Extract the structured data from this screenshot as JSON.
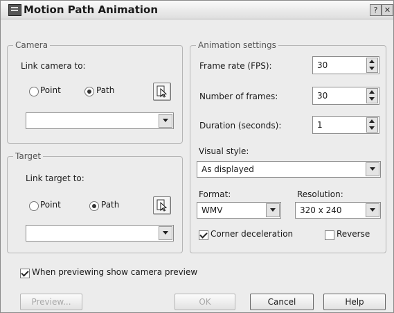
{
  "window": {
    "title": "Motion Path Animation",
    "help_glyph": "?",
    "close_glyph": "✕"
  },
  "camera": {
    "group_label": "Camera",
    "link_label": "Link camera to:",
    "point_label": "Point",
    "path_label": "Path",
    "selected": "Path",
    "path_select_value": ""
  },
  "target": {
    "group_label": "Target",
    "link_label": "Link target to:",
    "point_label": "Point",
    "path_label": "Path",
    "selected": "Path",
    "path_select_value": ""
  },
  "animation": {
    "group_label": "Animation settings",
    "frame_rate_label": "Frame rate (FPS):",
    "frame_rate_value": "30",
    "frames_label": "Number of frames:",
    "frames_value": "30",
    "duration_label": "Duration (seconds):",
    "duration_value": "1",
    "visual_style_label": "Visual style:",
    "visual_style_value": "As displayed",
    "format_label": "Format:",
    "format_value": "WMV",
    "resolution_label": "Resolution:",
    "resolution_value": "320 x 240",
    "corner_decel_label": "Corner deceleration",
    "corner_decel_checked": true,
    "reverse_label": "Reverse",
    "reverse_checked": false
  },
  "preview_checkbox": {
    "label": "When previewing show camera preview",
    "checked": true
  },
  "buttons": {
    "preview": "Preview...",
    "ok": "OK",
    "cancel": "Cancel",
    "help": "Help"
  },
  "icons": {
    "pick_point": "pick-point-icon",
    "dropdown": "chevron-down-icon",
    "spinner": "spinner-icon"
  }
}
